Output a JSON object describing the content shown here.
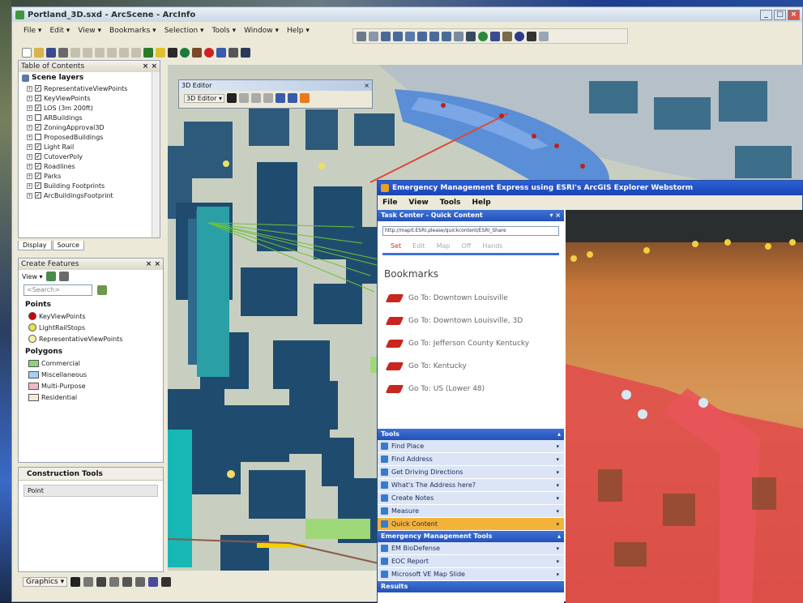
{
  "app": {
    "title": "Portland_3D.sxd - ArcScene - ArcInfo",
    "window_buttons": [
      "_",
      "□",
      "×"
    ]
  },
  "menu": [
    "File ▾",
    "Edit ▾",
    "View ▾",
    "Bookmarks ▾",
    "Selection ▾",
    "Tools ▾",
    "Window ▾",
    "Help ▾"
  ],
  "toc": {
    "title": "Table of Contents",
    "group": "Scene layers",
    "layers": [
      {
        "name": "RepresentativeViewPoints",
        "checked": true
      },
      {
        "name": "KeyViewPoints",
        "checked": true
      },
      {
        "name": "LOS (3m 200ft)",
        "checked": true
      },
      {
        "name": "ARBuildings",
        "checked": false
      },
      {
        "name": "ZoningApproval3D",
        "checked": true
      },
      {
        "name": "ProposedBuildings",
        "checked": false
      },
      {
        "name": "Light Rail",
        "checked": true
      },
      {
        "name": "CutoverPoly",
        "checked": true
      },
      {
        "name": "Roadlines",
        "checked": true
      },
      {
        "name": "Parks",
        "checked": true
      },
      {
        "name": "Building Footprints",
        "checked": true
      },
      {
        "name": "ArcBuildingsFootprint",
        "checked": true
      }
    ],
    "tabs": [
      "Display",
      "Source"
    ]
  },
  "create_features": {
    "title": "Create Features",
    "templates_label": "View ▾",
    "search_placeholder": "<Search>",
    "categories": [
      {
        "name": "Points",
        "items": [
          {
            "label": "KeyViewPoints",
            "color": "#d10000"
          },
          {
            "label": "LightRailStops",
            "color": "#e6e24a"
          },
          {
            "label": "RepresentativeViewPoints",
            "color": "#f5f2a6"
          }
        ]
      },
      {
        "name": "Polygons",
        "items": [
          {
            "label": "Commercial",
            "color": "#8fd27c"
          },
          {
            "label": "Miscellaneous",
            "color": "#9fd3f2"
          },
          {
            "label": "Multi-Purpose",
            "color": "#f0b9c8"
          },
          {
            "label": "Residential",
            "color": "#f4ead2"
          }
        ]
      }
    ]
  },
  "construction_tools": {
    "title": "Construction Tools",
    "items": [
      "Point"
    ]
  },
  "bottom_toolbar": {
    "label": "Graphics ▾"
  },
  "floating_toolbar": {
    "title": "3D Editor",
    "label": "3D Editor ▾"
  },
  "em_window": {
    "title": "Emergency Management Express using ESRI's ArcGIS Explorer Webstorm",
    "menu": [
      "File",
      "View",
      "Tools",
      "Help"
    ],
    "task_header": "Task Center - Quick Content",
    "url": "http://mapit.ESRI.please/quickcontent/ESRI_Share",
    "tabs": [
      "Set",
      "Edit",
      "Map",
      "Off",
      "Hands"
    ],
    "bookmarks_title": "Bookmarks",
    "bookmarks": [
      "Go To: Downtown Louisville",
      "Go To: Downtown Louisville, 3D",
      "Go To: Jefferson County Kentucky",
      "Go To: Kentucky",
      "Go To: US (Lower 48)"
    ],
    "tools_header": "Tools",
    "tools": [
      "Find Place",
      "Find Address",
      "Get Driving Directions",
      "What's The Address here?",
      "Create Notes",
      "Measure",
      "Quick Content"
    ],
    "em_tools_header": "Emergency Management Tools",
    "em_tools": [
      "EM BioDefense",
      "EOC Report",
      "Microsoft VE Map Slide"
    ],
    "results_header": "Results"
  }
}
